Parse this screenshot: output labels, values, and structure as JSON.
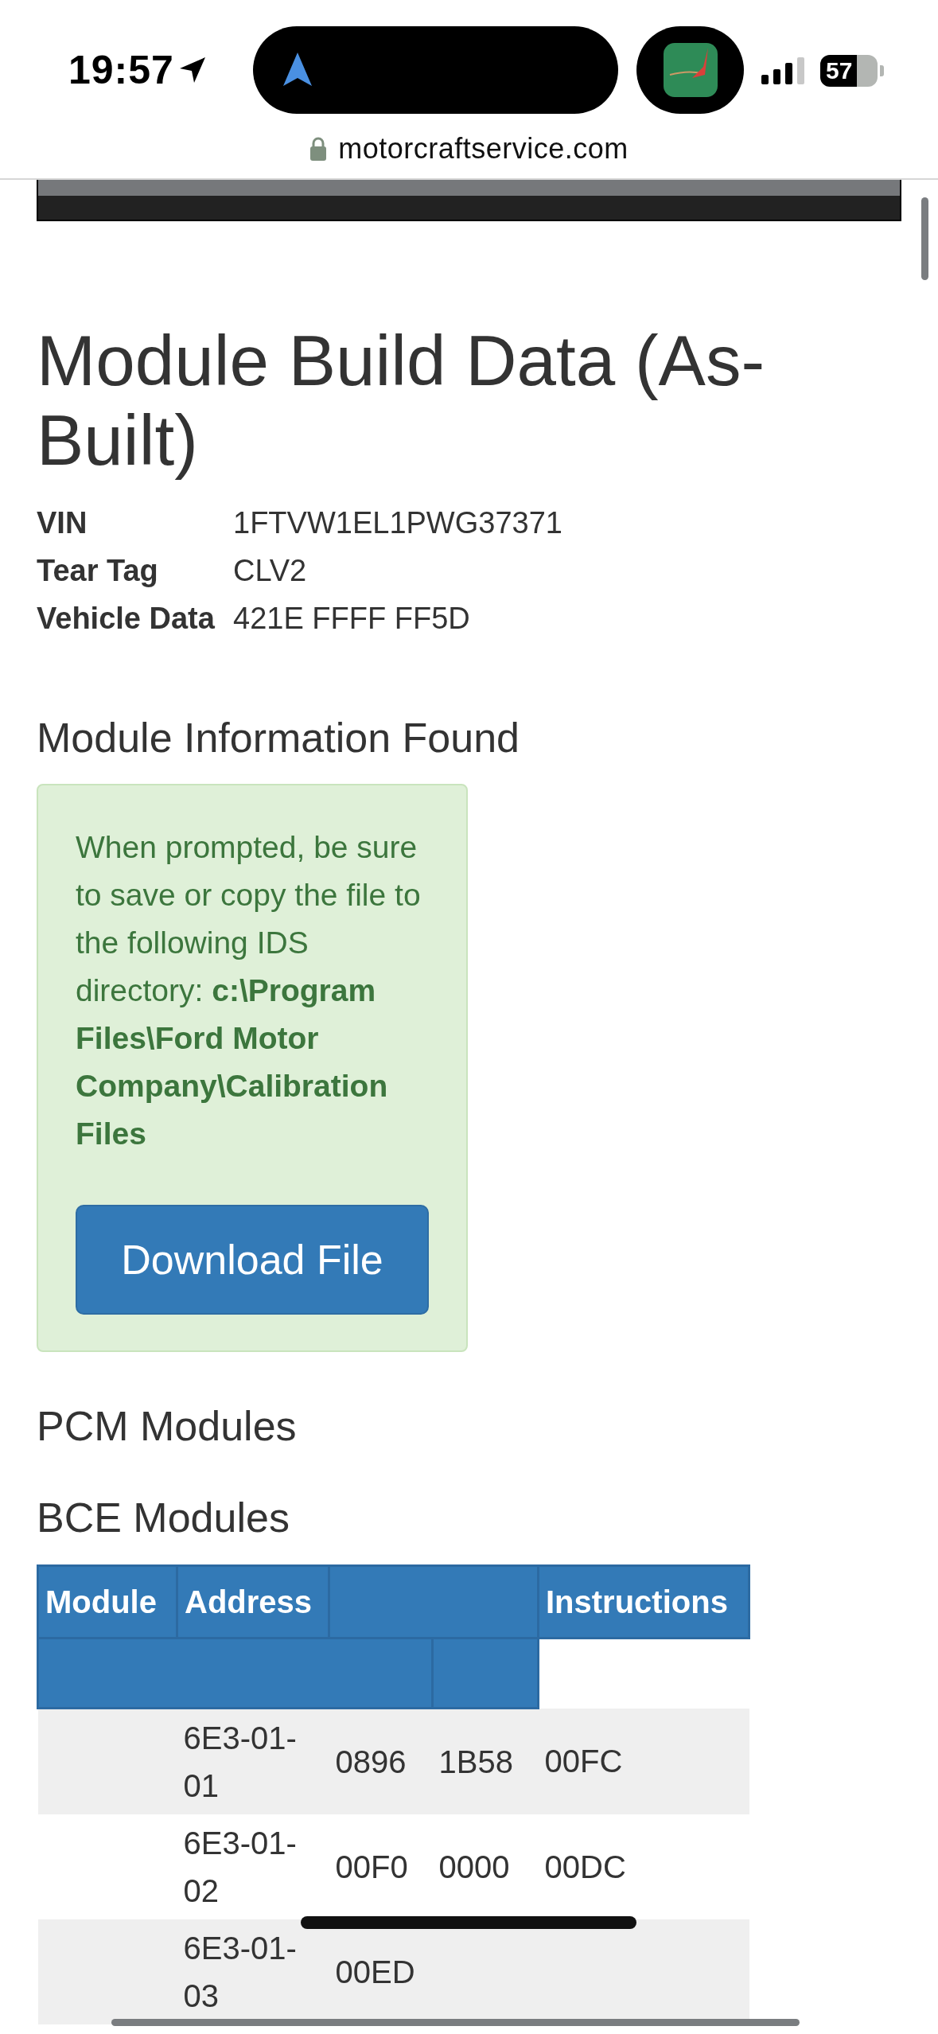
{
  "status_bar": {
    "time": "19:57",
    "battery": "57"
  },
  "address_bar": {
    "url": "motorcraftservice.com"
  },
  "page": {
    "title": "Module Build Data (As-Built)",
    "details": [
      {
        "label": "VIN",
        "value": "1FTVW1EL1PWG37371"
      },
      {
        "label": "Tear Tag",
        "value": "CLV2"
      },
      {
        "label": "Vehicle Data",
        "value": "421E FFFF FF5D"
      }
    ],
    "section_title": "Module Information Found",
    "notice": {
      "text": "When prompted, be sure to save or copy the file to the following IDS directory: **c:\\Program Files\\Ford Motor Company\\Calibration Files**",
      "button": "Download File"
    },
    "sections": [
      "PCM Modules",
      "BCE Modules"
    ],
    "table": {
      "columns": [
        {
          "kind": "label",
          "label": "Module"
        },
        {
          "kind": "label",
          "label": "Address"
        },
        {
          "kind": "blank"
        },
        {
          "kind": "label",
          "label": "Instructions"
        }
      ],
      "rows": [
        {
          "address": "6E3-01-01",
          "values": [
            "0896",
            "1B58",
            "00FC"
          ]
        },
        {
          "address": "6E3-01-02",
          "values": [
            "00F0",
            "0000",
            "00DC"
          ]
        },
        {
          "address": "6E3-01-03",
          "values": [
            "00ED"
          ]
        }
      ]
    }
  }
}
